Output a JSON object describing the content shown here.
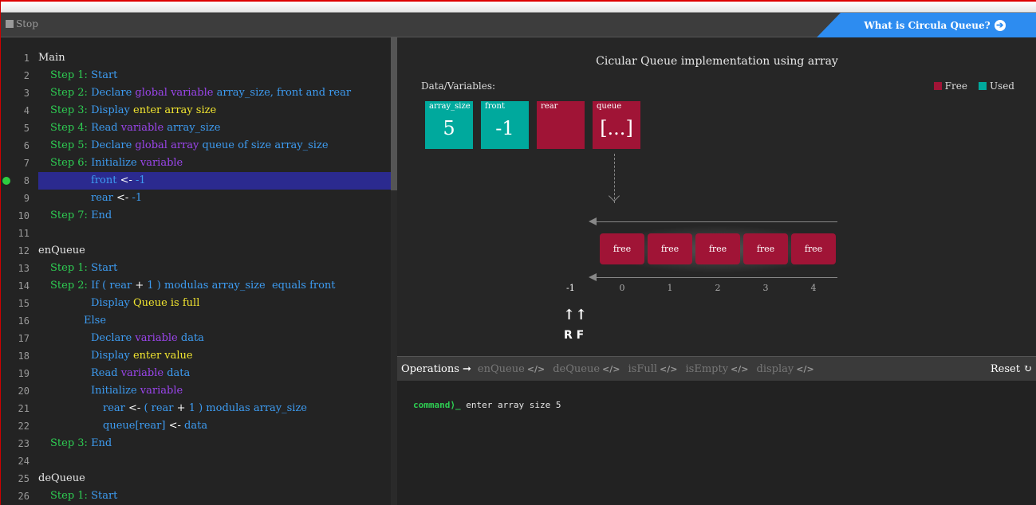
{
  "toolbar": {
    "stop_label": "Stop",
    "help_label": "What is Circula Queue?",
    "help_icon": "arrow-circle-right-icon"
  },
  "code": {
    "active_line": 8,
    "lines": [
      [
        {
          "t": "Main",
          "k": "plain"
        }
      ],
      [
        {
          "t": "Step 1: ",
          "k": "step"
        },
        {
          "t": "Start",
          "k": "blue"
        }
      ],
      [
        {
          "t": "Step 2: ",
          "k": "step"
        },
        {
          "t": "Declare ",
          "k": "blue"
        },
        {
          "t": "global variable ",
          "k": "purple"
        },
        {
          "t": "array_size, front and rear",
          "k": "blue"
        }
      ],
      [
        {
          "t": "Step 3: ",
          "k": "step"
        },
        {
          "t": "Display ",
          "k": "blue"
        },
        {
          "t": "enter array size",
          "k": "yellow"
        }
      ],
      [
        {
          "t": "Step 4: ",
          "k": "step"
        },
        {
          "t": "Read ",
          "k": "blue"
        },
        {
          "t": "variable ",
          "k": "purple"
        },
        {
          "t": "array_size",
          "k": "blue"
        }
      ],
      [
        {
          "t": "Step 5: ",
          "k": "step"
        },
        {
          "t": "Declare ",
          "k": "blue"
        },
        {
          "t": "global array ",
          "k": "purple"
        },
        {
          "t": "queue of size array_size",
          "k": "blue"
        }
      ],
      [
        {
          "t": "Step 6: ",
          "k": "step"
        },
        {
          "t": "Initialize ",
          "k": "blue"
        },
        {
          "t": "variable",
          "k": "purple"
        }
      ],
      [
        {
          "t": "front ",
          "k": "blue"
        },
        {
          "t": "<- ",
          "k": "white"
        },
        {
          "t": "-1",
          "k": "blue"
        }
      ],
      [
        {
          "t": "rear ",
          "k": "blue"
        },
        {
          "t": "<- ",
          "k": "white"
        },
        {
          "t": "-1",
          "k": "blue"
        }
      ],
      [
        {
          "t": "Step 7: ",
          "k": "step"
        },
        {
          "t": "End",
          "k": "blue"
        }
      ],
      [],
      [
        {
          "t": "enQueue",
          "k": "plain"
        }
      ],
      [
        {
          "t": "Step 1: ",
          "k": "step"
        },
        {
          "t": "Start",
          "k": "blue"
        }
      ],
      [
        {
          "t": "Step 2: ",
          "k": "step"
        },
        {
          "t": "If ( ",
          "k": "blue"
        },
        {
          "t": "rear ",
          "k": "blue"
        },
        {
          "t": "+ ",
          "k": "white"
        },
        {
          "t": "1 ) modulas array_size  equals front",
          "k": "blue"
        }
      ],
      [
        {
          "t": "Display ",
          "k": "blue"
        },
        {
          "t": "Queue is full",
          "k": "yellow"
        }
      ],
      [
        {
          "t": "Else",
          "k": "blue"
        }
      ],
      [
        {
          "t": "Declare ",
          "k": "blue"
        },
        {
          "t": "variable ",
          "k": "purple"
        },
        {
          "t": "data",
          "k": "blue"
        }
      ],
      [
        {
          "t": "Display ",
          "k": "blue"
        },
        {
          "t": "enter value",
          "k": "yellow"
        }
      ],
      [
        {
          "t": "Read ",
          "k": "blue"
        },
        {
          "t": "variable ",
          "k": "purple"
        },
        {
          "t": "data",
          "k": "blue"
        }
      ],
      [
        {
          "t": "Initialize ",
          "k": "blue"
        },
        {
          "t": "variable",
          "k": "purple"
        }
      ],
      [
        {
          "t": "rear ",
          "k": "blue"
        },
        {
          "t": "<- ",
          "k": "white"
        },
        {
          "t": "( rear ",
          "k": "blue"
        },
        {
          "t": "+ ",
          "k": "white"
        },
        {
          "t": "1 ) modulas array_size",
          "k": "blue"
        }
      ],
      [
        {
          "t": "queue[rear] ",
          "k": "blue"
        },
        {
          "t": "<- ",
          "k": "white"
        },
        {
          "t": "data",
          "k": "blue"
        }
      ],
      [
        {
          "t": "Step 3: ",
          "k": "step"
        },
        {
          "t": "End",
          "k": "blue"
        }
      ],
      [],
      [
        {
          "t": "deQueue",
          "k": "plain"
        }
      ],
      [
        {
          "t": "Step 1: ",
          "k": "step"
        },
        {
          "t": "Start",
          "k": "blue"
        }
      ]
    ]
  },
  "visual": {
    "title": "Cicular Queue implementation using array",
    "variables_label": "Data/Variables:",
    "legend": [
      {
        "label": "Free",
        "color": "#a01436"
      },
      {
        "label": "Used",
        "color": "#00a99d"
      }
    ],
    "variables": [
      {
        "name": "array_size",
        "value": "5",
        "state": "used"
      },
      {
        "name": "front",
        "value": "-1",
        "state": "used"
      },
      {
        "name": "rear",
        "value": "",
        "state": "free"
      },
      {
        "name": "queue",
        "value": "[...]",
        "state": "free"
      }
    ],
    "cells": [
      "free",
      "free",
      "free",
      "free",
      "free"
    ],
    "indices": [
      "0",
      "1",
      "2",
      "3",
      "4"
    ],
    "pointer_index": "-1",
    "pointer_arrows": "↑↑",
    "pointer_labels": "R F"
  },
  "operations": {
    "label": "Operations ➞",
    "items": [
      "enQueue",
      "deQueue",
      "isFull",
      "isEmpty",
      "display"
    ],
    "code_icon": "</>",
    "reset_label": "Reset ↻"
  },
  "terminal": {
    "prompt": "command⟩_",
    "text": " enter array size 5"
  }
}
